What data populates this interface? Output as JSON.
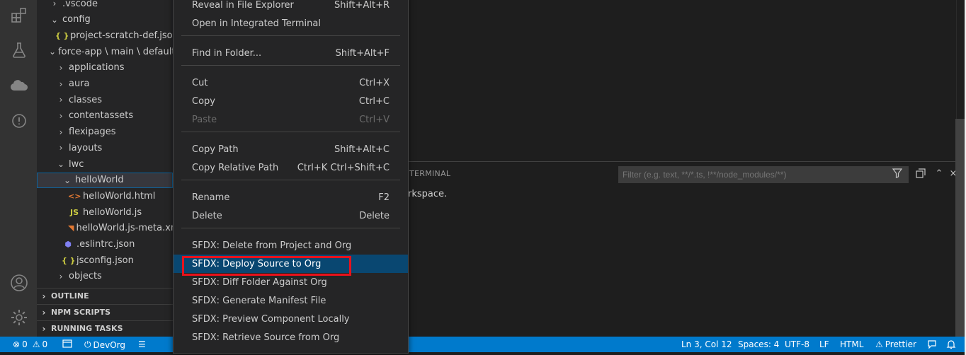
{
  "explorer": {
    "rows": [
      {
        "label": ".vscode",
        "chev": "›",
        "icon": "",
        "indent": 1
      },
      {
        "label": "config",
        "chev": "⌄",
        "icon": "",
        "indent": 1
      },
      {
        "label": "project-scratch-def.json",
        "chev": "",
        "icon": "{ }",
        "indent": 2
      },
      {
        "label": "force-app \\ main \\ default",
        "chev": "⌄",
        "icon": "",
        "indent": 1
      },
      {
        "label": "applications",
        "chev": "›",
        "icon": "",
        "indent": 2
      },
      {
        "label": "aura",
        "chev": "›",
        "icon": "",
        "indent": 2
      },
      {
        "label": "classes",
        "chev": "›",
        "icon": "",
        "indent": 2
      },
      {
        "label": "contentassets",
        "chev": "›",
        "icon": "",
        "indent": 2
      },
      {
        "label": "flexipages",
        "chev": "›",
        "icon": "",
        "indent": 2
      },
      {
        "label": "layouts",
        "chev": "›",
        "icon": "",
        "indent": 2
      },
      {
        "label": "lwc",
        "chev": "⌄",
        "icon": "",
        "indent": 2
      },
      {
        "label": "helloWorld",
        "chev": "⌄",
        "icon": "",
        "indent": 3
      },
      {
        "label": "helloWorld.html",
        "chev": "",
        "icon": "<>",
        "indent": 4
      },
      {
        "label": "helloWorld.js",
        "chev": "",
        "icon": "JS",
        "indent": 4
      },
      {
        "label": "helloWorld.js-meta.xml",
        "chev": "",
        "icon": "rss",
        "indent": 4
      },
      {
        "label": ".eslintrc.json",
        "chev": "",
        "icon": "eslint",
        "indent": 3
      },
      {
        "label": "jsconfig.json",
        "chev": "",
        "icon": "{ }",
        "indent": 3
      },
      {
        "label": "objects",
        "chev": "›",
        "icon": "",
        "indent": 2
      }
    ],
    "sections": [
      "OUTLINE",
      "NPM SCRIPTS",
      "RUNNING TASKS"
    ]
  },
  "panel": {
    "tab_label": "TERMINAL",
    "filter_placeholder": "Filter (e.g. text, **/*.ts, !**/node_modules/**)",
    "message": "rkspace."
  },
  "context_menu": {
    "groups": [
      [
        {
          "label": "Reveal in File Explorer",
          "shortcut": "Shift+Alt+R"
        },
        {
          "label": "Open in Integrated Terminal",
          "shortcut": ""
        }
      ],
      [
        {
          "label": "Find in Folder...",
          "shortcut": "Shift+Alt+F"
        }
      ],
      [
        {
          "label": "Cut",
          "shortcut": "Ctrl+X"
        },
        {
          "label": "Copy",
          "shortcut": "Ctrl+C"
        },
        {
          "label": "Paste",
          "shortcut": "Ctrl+V",
          "disabled": true
        }
      ],
      [
        {
          "label": "Copy Path",
          "shortcut": "Shift+Alt+C"
        },
        {
          "label": "Copy Relative Path",
          "shortcut": "Ctrl+K Ctrl+Shift+C"
        }
      ],
      [
        {
          "label": "Rename",
          "shortcut": "F2"
        },
        {
          "label": "Delete",
          "shortcut": "Delete"
        }
      ],
      [
        {
          "label": "SFDX: Delete from Project and Org",
          "shortcut": ""
        },
        {
          "label": "SFDX: Deploy Source to Org",
          "shortcut": "",
          "active": true
        },
        {
          "label": "SFDX: Diff Folder Against Org",
          "shortcut": ""
        },
        {
          "label": "SFDX: Generate Manifest File",
          "shortcut": ""
        },
        {
          "label": "SFDX: Preview Component Locally",
          "shortcut": ""
        },
        {
          "label": "SFDX: Retrieve Source from Org",
          "shortcut": ""
        }
      ]
    ]
  },
  "status_bar": {
    "errors": "0",
    "warnings": "0",
    "org": "DevOrg",
    "position": "Ln 3, Col 12",
    "spaces": "Spaces: 4",
    "encoding": "UTF-8",
    "eol": "LF",
    "language": "HTML",
    "prettier": "Prettier"
  },
  "colors": {
    "status_bar": "#007acc",
    "menu_active": "#094771",
    "highlight_box": "#e8121c"
  }
}
